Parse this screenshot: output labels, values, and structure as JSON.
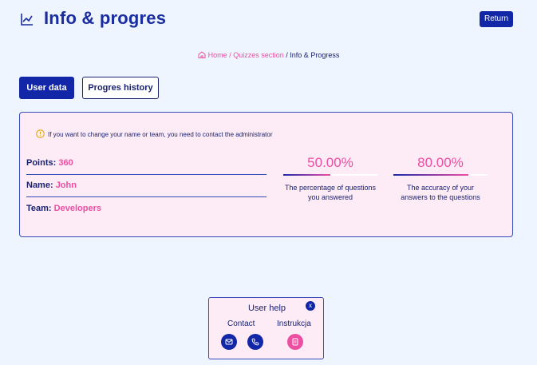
{
  "header": {
    "title": "Info & progres",
    "return_label": "Return",
    "icon": "chart-line-icon"
  },
  "breadcrumb": {
    "home": "Home",
    "separator": "/",
    "quizzes": "Quizzes section",
    "current": "Info & Progress"
  },
  "tabs": [
    {
      "label": "User data",
      "active": true
    },
    {
      "label": "Progres history",
      "active": false
    }
  ],
  "card": {
    "notice": "If you want to change your name or team, you need to contact the administrator",
    "fields": {
      "points_label": "Points:",
      "points_value": "360",
      "name_label": "Name:",
      "name_value": "John",
      "team_label": "Team:",
      "team_value": "Developers"
    },
    "stats": [
      {
        "value_text": "50.00%",
        "fraction": 0.5,
        "description": "The percentage of questions you answered"
      },
      {
        "value_text": "80.00%",
        "fraction": 0.8,
        "description": "The accuracy of your answers to the questions"
      }
    ]
  },
  "help": {
    "title": "User help",
    "close_label": "x",
    "contact_label": "Contact",
    "instructions_label": "Instrukcja"
  },
  "colors": {
    "primary": "#1227a8",
    "accent": "#ec4fa2",
    "background": "#eef5fe",
    "card_background": "#fdecf6"
  }
}
